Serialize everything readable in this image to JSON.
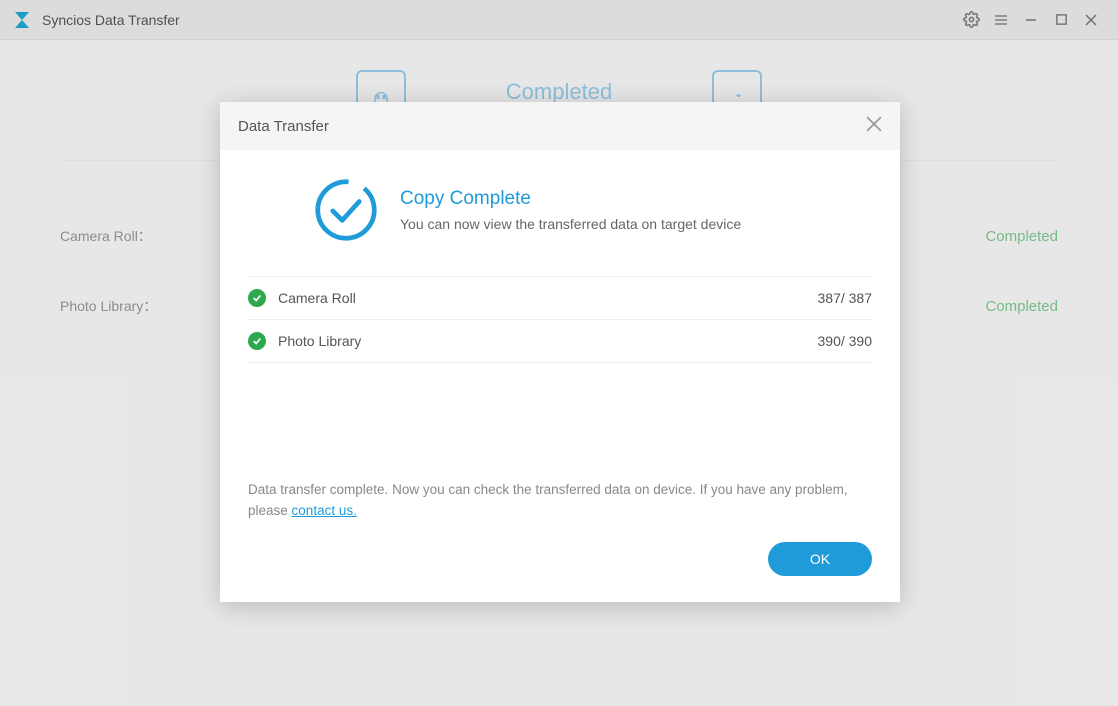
{
  "app": {
    "title": "Syncios Data Transfer"
  },
  "background": {
    "headerStatus": "Completed",
    "rows": [
      {
        "label": "Camera Roll：",
        "status": "Completed"
      },
      {
        "label": "Photo Library：",
        "status": "Completed"
      }
    ]
  },
  "modal": {
    "title": "Data Transfer",
    "resultHeading": "Copy Complete",
    "resultSubtext": "You can now view the transferred data on target device",
    "items": [
      {
        "name": "Camera Roll",
        "count": "387/ 387"
      },
      {
        "name": "Photo Library",
        "count": "390/ 390"
      }
    ],
    "footerText1": "Data transfer complete. Now you can check the transferred data on device. If you have any problem, please ",
    "contactLink": "contact us.",
    "okLabel": "OK"
  }
}
